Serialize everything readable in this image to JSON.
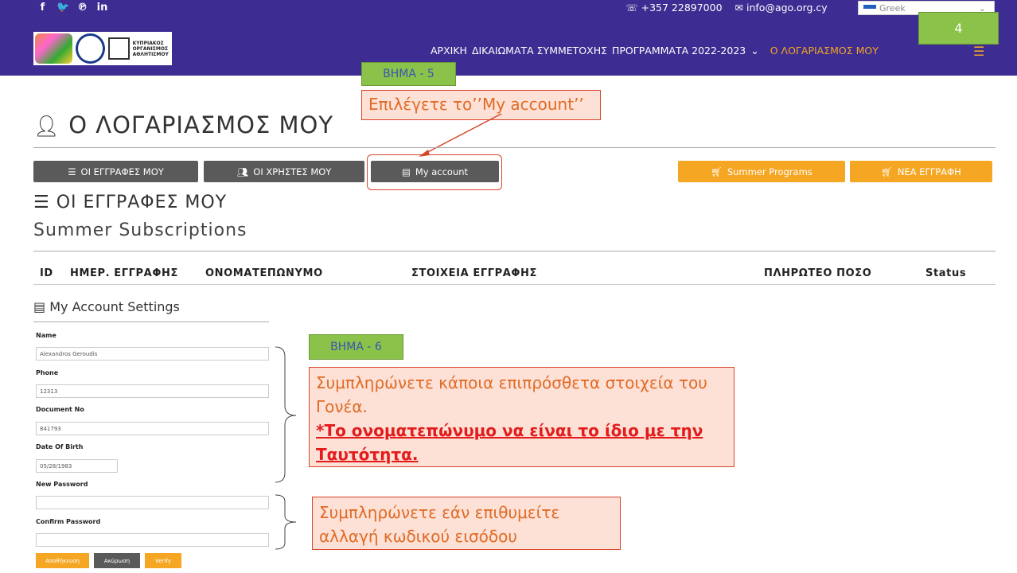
{
  "slide_number": "4",
  "topbar": {
    "social_icons": [
      "facebook-icon",
      "twitter-icon",
      "pinterest-icon",
      "linkedin-icon"
    ],
    "social_glyphs": [
      "f",
      "🐦",
      "℗",
      "in"
    ],
    "phone": "+357 22897000",
    "email": "info@ago.org.cy",
    "language": "Greek"
  },
  "logo": {
    "org_text": "ΚΥΠΡΙΑΚΟΣ ΟΡΓΑΝΙΣΜΟΣ ΑΘΛΗΤΙΣΜΟΥ"
  },
  "nav": {
    "home": "ΑΡΧΙΚΗ",
    "participation": "ΔΙΚΑΙΩΜΑΤΑ ΣΥΜΜΕΤΟΧΗΣ",
    "programs": "ΠΡΟΓΡΑΜΜΑΤΑ 2022-2023",
    "programs_caret": "⌄",
    "account": "Ο ΛΟΓΑΡΙΑΣΜΟΣ ΜΟΥ"
  },
  "step5": {
    "label": "ΒΗΜΑ - 5",
    "callout": "Επιλέγετε το’’My account’’"
  },
  "page_title": "Ο ΛΟΓΑΡΙΑΣΜΟΣ ΜΟΥ",
  "buttons": {
    "registrations": "ΟΙ ΕΓΓΡΑΦΕΣ ΜΟΥ",
    "users": "ΟΙ ΧΡΗΣΤΕΣ ΜΟΥ",
    "my_account": "My account",
    "summer_programs": "Summer Programs",
    "new_registration": "ΝΕΑ ΕΓΓΡΑΦΗ"
  },
  "section_title": "ΟΙ ΕΓΓΡΑΦΕΣ ΜΟΥ",
  "subsection_title": "Summer Subscriptions",
  "table_headers": [
    "ID",
    "ΗΜΕΡ. ΕΓΓΡΑΦΗΣ",
    "ΟΝΟΜΑΤΕΠΩΝΥΜΟ",
    "ΣΤΟΙΧΕΙΑ ΕΓΓΡΑΦΗΣ",
    "ΠΛΗΡΩΤΕΟ ΠΟΣΟ",
    "Status"
  ],
  "settings": {
    "title": "My Account Settings",
    "name_label": "Name",
    "name_value": "Alexandros Geroudis",
    "phone_label": "Phone",
    "phone_value": "12313",
    "doc_label": "Document No",
    "doc_value": "841793",
    "dob_label": "Date Of Birth",
    "dob_value": "05/28/1983",
    "new_password_label": "New Password",
    "confirm_password_label": "Confirm Password",
    "save": "Αποθήκευση",
    "cancel": "Ακύρωση",
    "verify": "Verify"
  },
  "step6": {
    "label": "ΒΗΜΑ - 6",
    "callout_line1": "Συμπληρώνετε κάποια επιπρόσθετα στοιχεία του Γονέα.",
    "callout_emphasis": "*Το ονοματεπώνυμο να είναι το ίδιο με την Ταυτότητα."
  },
  "password_callout": "Συμπληρώνετε εάν επιθυμείτε αλλαγή κωδικού εισόδου"
}
